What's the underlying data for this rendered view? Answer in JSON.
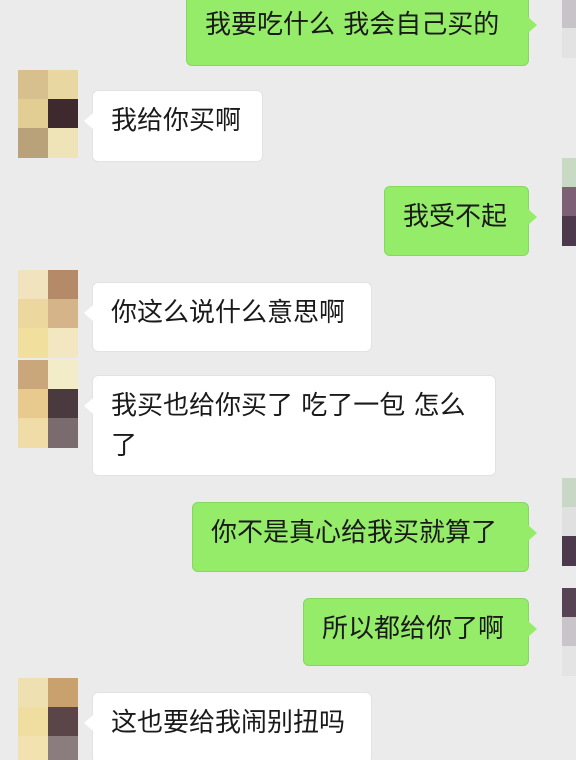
{
  "conversation": {
    "messages": [
      {
        "side": "out",
        "text": "我要吃什么 我会自己买的"
      },
      {
        "side": "in",
        "text": "我给你买啊"
      },
      {
        "side": "out",
        "text": "我受不起"
      },
      {
        "side": "in",
        "text": "你这么说什么意思啊"
      },
      {
        "side": "in",
        "text": "我买也给你买了 吃了一包 怎么了"
      },
      {
        "side": "out",
        "text": "你不是真心给我买就算了"
      },
      {
        "side": "out",
        "text": "所以都给你了啊"
      },
      {
        "side": "in",
        "text": "这也要给我闹别扭吗"
      }
    ]
  },
  "colors": {
    "background": "#ebebeb",
    "outgoing_bubble": "#95ec69",
    "incoming_bubble": "#ffffff",
    "text": "#1a1a1a"
  },
  "icons": {
    "contact_avatar": "pixelated-avatar-icon",
    "self_avatar": "pixelated-avatar-icon"
  }
}
